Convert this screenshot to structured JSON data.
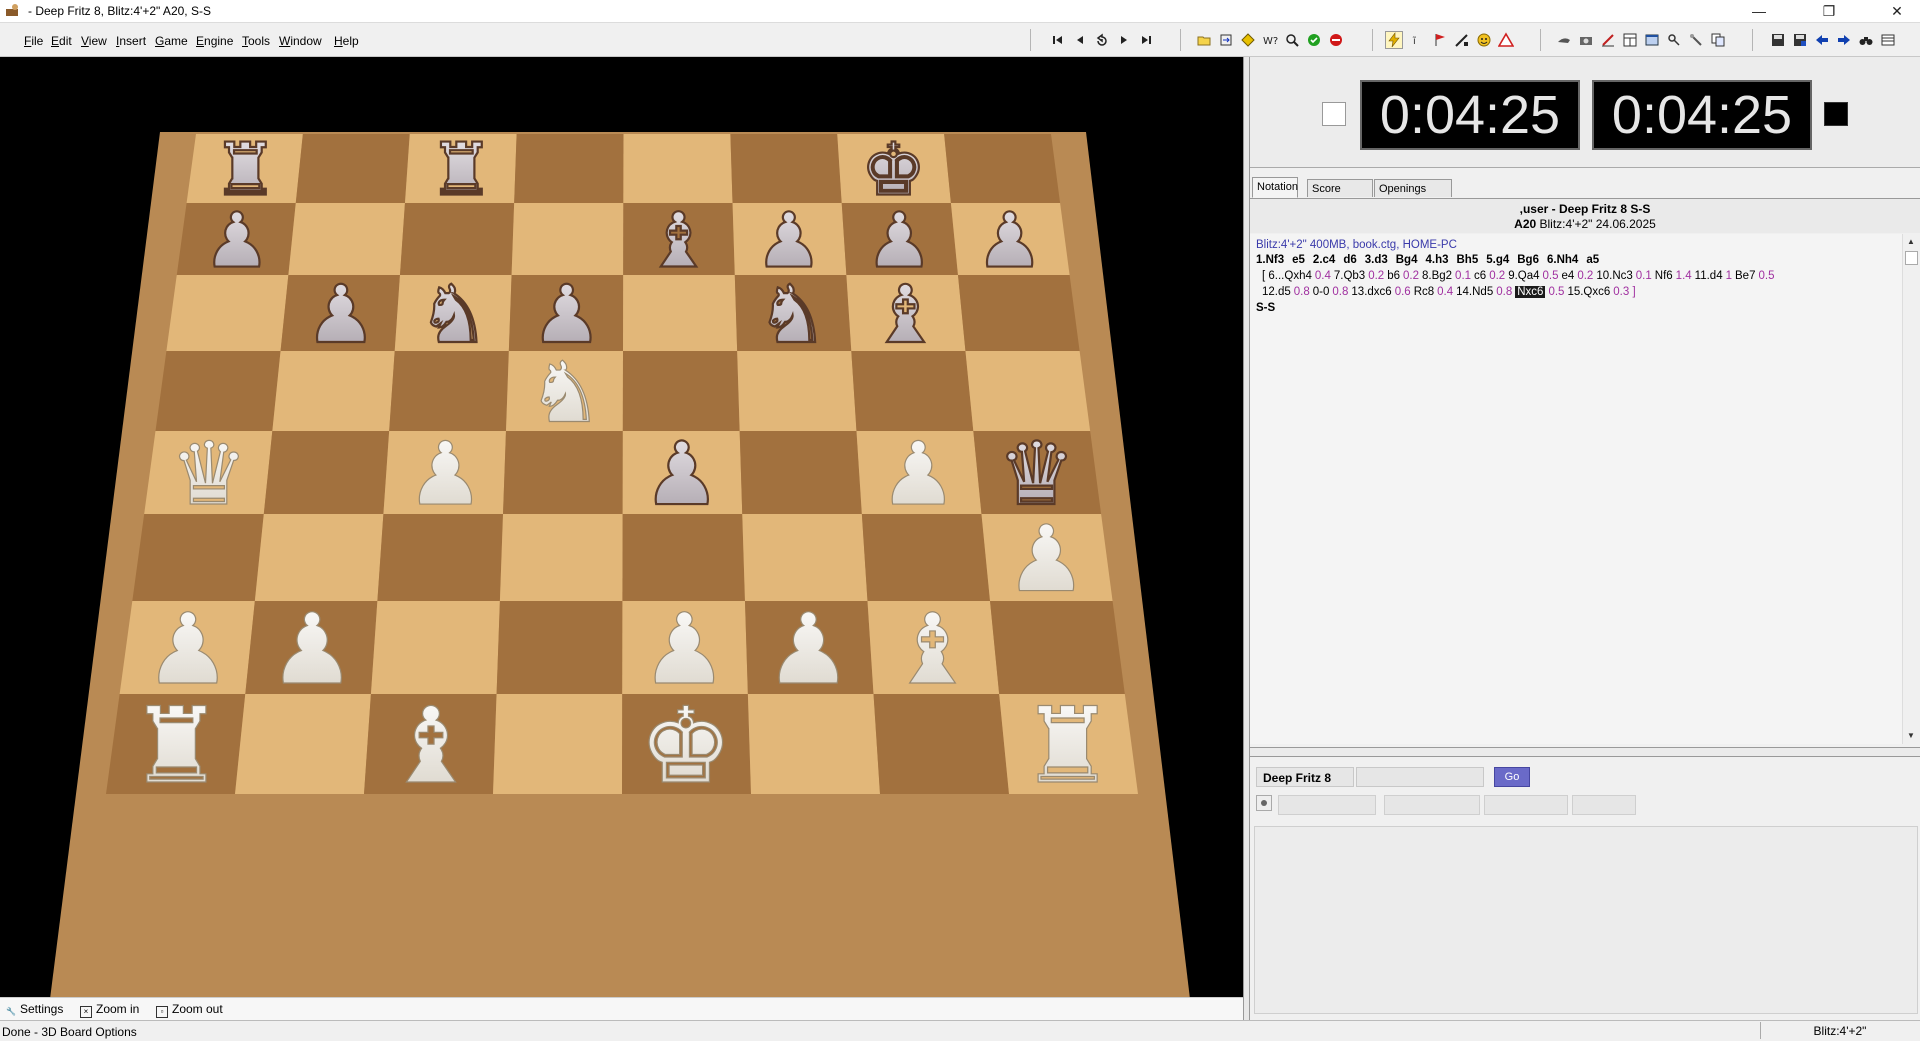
{
  "window": {
    "title": "- Deep Fritz 8, Blitz:4'+2\"  A20, S-S",
    "minimize": "—",
    "maximize": "❐",
    "close": "✕"
  },
  "menu": [
    {
      "u": "F",
      "rest": "ile"
    },
    {
      "u": "E",
      "rest": "dit"
    },
    {
      "u": "V",
      "rest": "iew"
    },
    {
      "u": "I",
      "rest": "nsert"
    },
    {
      "u": "G",
      "rest": "ame"
    },
    {
      "u": "E",
      "rest": "ngine"
    },
    {
      "u": "T",
      "rest": "ools"
    },
    {
      "u": "W",
      "rest": "indow"
    },
    {
      "u": "H",
      "rest": "elp"
    }
  ],
  "board": {
    "colors": {
      "light": "#e2b779",
      "dark": "#a2713e",
      "frame": "#b98a54",
      "white_piece": "#f2efe8",
      "black_piece": "#5a3a28"
    },
    "squares": [
      [
        "bR",
        "",
        "bR",
        "",
        "",
        "",
        "bK",
        ""
      ],
      [
        "bP",
        "",
        "",
        "",
        "bB",
        "bP",
        "bP",
        "bP"
      ],
      [
        "",
        "bP",
        "bN",
        "bP",
        "",
        "bN",
        "bB",
        ""
      ],
      [
        "",
        "",
        "",
        "wN",
        "",
        "",
        "",
        ""
      ],
      [
        "wQ",
        "",
        "wP",
        "",
        "bP",
        "",
        "wP",
        "bQ"
      ],
      [
        "",
        "",
        "",
        "",
        "",
        "",
        "",
        "wP"
      ],
      [
        "wP",
        "wP",
        "",
        "",
        "wP",
        "wP",
        "wB",
        ""
      ],
      [
        "wR",
        "",
        "wB",
        "",
        "wK",
        "",
        "",
        "wR"
      ]
    ]
  },
  "bottom_bar": {
    "settings": "Settings",
    "zoom_in": "Zoom in",
    "zoom_out": "Zoom out"
  },
  "status": {
    "left": "Done - 3D Board Options",
    "right": "Blitz:4'+2\""
  },
  "clocks": {
    "white": "0:04:25",
    "black": "0:04:25"
  },
  "tabs": [
    "Notation",
    "Score sheet",
    "Openings Book"
  ],
  "game_header": {
    "players": ",user - Deep Fritz 8  S-S",
    "eco": "A20",
    "info": "Blitz:4'+2\" 24.06.2025"
  },
  "notation": {
    "header_line": "Blitz:4'+2\"  400MB, book.ctg, HOME-PC",
    "main_moves": [
      "1.Nf3",
      "e5",
      "2.c4",
      "d6",
      "3.d3",
      "Bg4",
      "4.h3",
      "Bh5",
      "5.g4",
      "Bg6",
      "6.Nh4",
      "a5"
    ],
    "variation_line1": [
      {
        "m": "[ 6...Qxh4",
        "e": "0.4"
      },
      {
        "m": "7.Qb3",
        "e": "0.2"
      },
      {
        "m": "b6",
        "e": "0.2"
      },
      {
        "m": "8.Bg2",
        "e": "0.1"
      },
      {
        "m": "c6",
        "e": "0.2"
      },
      {
        "m": "9.Qa4",
        "e": "0.5"
      },
      {
        "m": "e4",
        "e": "0.2"
      },
      {
        "m": "10.Nc3",
        "e": "0.1"
      },
      {
        "m": "Nf6",
        "e": "1.4"
      },
      {
        "m": "11.d4",
        "e": "1"
      },
      {
        "m": "Be7",
        "e": "0.5"
      }
    ],
    "variation_line2": [
      {
        "m": "12.d5",
        "e": "0.8"
      },
      {
        "m": "0-0",
        "e": "0.8"
      },
      {
        "m": "13.dxc6",
        "e": "0.6"
      },
      {
        "m": "Rc8",
        "e": "0.4"
      },
      {
        "m": "14.Nd5",
        "e": "0.8"
      },
      {
        "m": "Nxc6",
        "e": "0.5",
        "highlight": true
      },
      {
        "m": "15.Qxc6",
        "e": "0.3 ]"
      }
    ],
    "result_line": "S-S"
  },
  "engine": {
    "name": "Deep Fritz 8",
    "go_label": "Go"
  }
}
